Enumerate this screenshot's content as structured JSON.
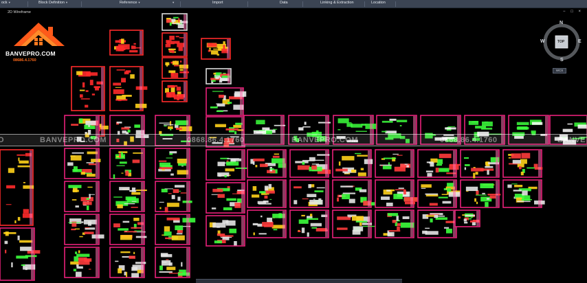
{
  "ribbon": {
    "tabs": [
      {
        "label": "ock",
        "caret": true
      },
      {
        "label": "Block Definition",
        "caret": true
      },
      {
        "label": "Reference",
        "caret": true
      },
      {
        "label": "",
        "caret": true
      },
      {
        "label": "Import",
        "caret": false
      },
      {
        "label": "Data",
        "caret": false
      },
      {
        "label": "Linking & Extraction",
        "caret": false
      },
      {
        "label": "Location",
        "caret": false
      }
    ]
  },
  "viewport": {
    "label": "2D Wireframe"
  },
  "window_controls": "− □ ×",
  "logo": {
    "brand": "BANVEPRO.COM",
    "phone": "08686.4.1760"
  },
  "viewcube": {
    "n": "N",
    "s": "S",
    "e": "E",
    "w": "W",
    "face": "TOP",
    "wcs": "WCS"
  },
  "watermark": {
    "items": [
      "O",
      "BANVEPRO.COM",
      "0868.86.4.1760",
      "BANVEPRO.COM",
      "0868.86.4.1760",
      "BANVE"
    ]
  },
  "colors": {
    "frame": "#e8207a",
    "title_red": "#ff2a2a",
    "plan_green": "#3cff3c",
    "plan_yellow": "#ffd21a",
    "logo_orange": "#ff6a1a"
  }
}
